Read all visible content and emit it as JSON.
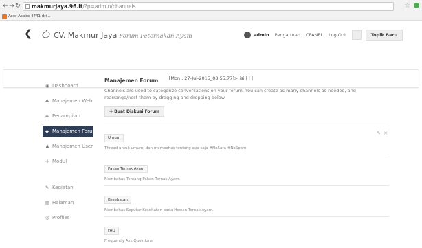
{
  "browser": {
    "url_host": "makmurjaya.96.lt",
    "url_path": "/?p=admin/channels",
    "bookmark": "Acer Aspire 4741 dri..."
  },
  "header": {
    "brand": "CV. Makmur Jaya",
    "subtitle": "Forum Peternakan Ayam",
    "user": "admin",
    "nav": [
      "Pengaturan",
      "CPANEL",
      "Log Out"
    ],
    "new_topic": "Topik Baru",
    "datetime": "[Mon , 27-Jul-2015_08:55:77]> isi | | |"
  },
  "sidebar": {
    "items": [
      {
        "label": "Dashboard",
        "icon": "dashboard-icon",
        "glyph": "◉"
      },
      {
        "label": "Manajemen Web",
        "icon": "gear-icon",
        "glyph": "✱"
      },
      {
        "label": "Penampilan",
        "icon": "eye-icon",
        "glyph": "◈"
      },
      {
        "label": "Manajemen Forum",
        "icon": "tag-icon",
        "glyph": "◆",
        "active": true
      },
      {
        "label": "Manajemen User",
        "icon": "users-icon",
        "glyph": "♟"
      },
      {
        "label": "Modul",
        "icon": "puzzle-icon",
        "glyph": "✚"
      },
      {
        "label": "Kegiatan",
        "icon": "pencil-icon",
        "glyph": "✎"
      },
      {
        "label": "Halaman",
        "icon": "page-icon",
        "glyph": "▤"
      },
      {
        "label": "Profiles",
        "icon": "profile-icon",
        "glyph": "◎"
      }
    ]
  },
  "main": {
    "title": "Manajemen Forum",
    "description": "Channels are used to categorize conversations on your forum. You can create as many channels as needed, and rearrange/nest them by dragging and dropping below.",
    "create_button": "Buat Diskusi Forum",
    "forums": [
      {
        "name": "Umum",
        "description": "Thread untuk umum, dan membahas tentang apa saja #NoSara #NoSpam"
      },
      {
        "name": "Pakan Ternak Ayam",
        "description": "Membahas Tentang Pakan Ternak Ayam."
      },
      {
        "name": "Kesehatan",
        "description": "Membahas Seputar Kesehatan pada Hewan Ternak Ayam."
      },
      {
        "name": "FAQ",
        "description": "Frequently Ask Questions"
      }
    ]
  },
  "colors": {
    "active_sidebar": "#2e3e57",
    "text": "#555555"
  }
}
